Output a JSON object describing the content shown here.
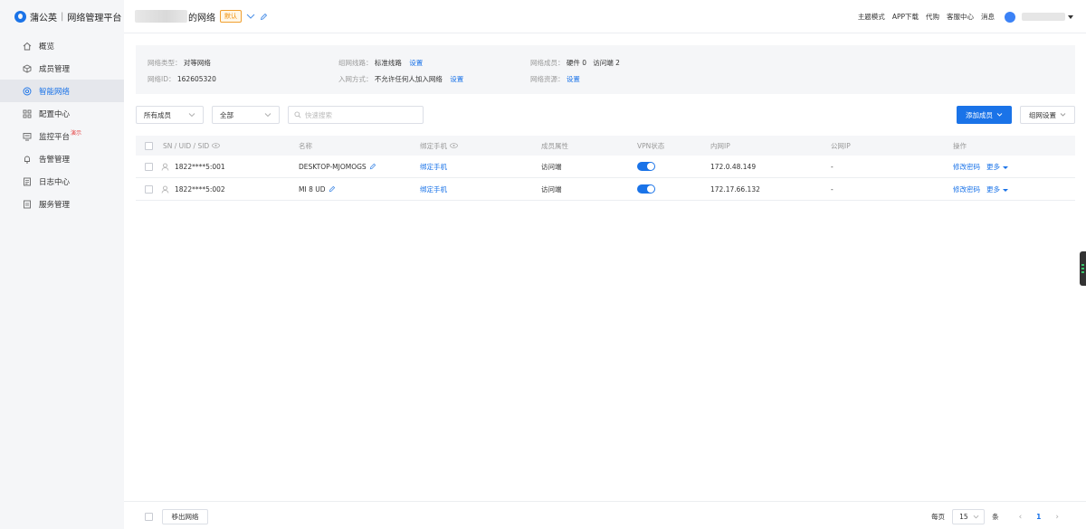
{
  "app": {
    "brand": "蒲公英",
    "platform": "网络管理平台"
  },
  "sidebar": {
    "items": [
      {
        "label": "概览",
        "icon": "home-icon"
      },
      {
        "label": "成员管理",
        "icon": "cube-icon"
      },
      {
        "label": "智能网络",
        "icon": "network-icon",
        "active": true
      },
      {
        "label": "配置中心",
        "icon": "grid-icon"
      },
      {
        "label": "监控平台",
        "icon": "monitor-icon",
        "badge": "演示"
      },
      {
        "label": "告警管理",
        "icon": "bell-icon"
      },
      {
        "label": "日志中心",
        "icon": "log-icon"
      },
      {
        "label": "服务管理",
        "icon": "service-icon"
      }
    ]
  },
  "header": {
    "network_title_suffix": "的网络",
    "default_tag": "默认",
    "links": [
      "主题模式",
      "APP下载",
      "代购",
      "客服中心",
      "消息"
    ]
  },
  "info": {
    "type_key": "网络类型：",
    "type_val": "对等网络",
    "route_key": "组网线路：",
    "route_val": "标准线路",
    "route_link": "设置",
    "members_key": "网络成员：",
    "members_val": "硬件 0   访问端 2",
    "id_key": "网络ID：",
    "id_val": "162605320",
    "join_key": "入网方式：",
    "join_val": "不允许任何人加入网络",
    "join_link": "设置",
    "res_key": "网络资源：",
    "res_link": "设置"
  },
  "filters": {
    "member_select": "所有成员",
    "status_select": "全部",
    "search_placeholder": "快速搜索",
    "add_member": "添加成员",
    "network_settings": "组网设置"
  },
  "table": {
    "headers": {
      "sn": "SN / UID / SID",
      "name": "名称",
      "phone": "绑定手机",
      "attr": "成员属性",
      "vpn": "VPN状态",
      "lan_ip": "内网IP",
      "wan_ip": "公网IP",
      "ops": "操作"
    },
    "rows": [
      {
        "sn": "1822****5:001",
        "name": "DESKTOP-MJOMOGS",
        "phone": "绑定手机",
        "attr": "访问端",
        "vpn_on": true,
        "lan_ip": "172.0.48.149",
        "wan_ip": "-",
        "op_edit": "修改密码",
        "op_more": "更多"
      },
      {
        "sn": "1822****5:002",
        "name": "MI 8 UD",
        "phone": "绑定手机",
        "attr": "访问端",
        "vpn_on": true,
        "lan_ip": "172.17.66.132",
        "wan_ip": "-",
        "op_edit": "修改密码",
        "op_more": "更多"
      }
    ]
  },
  "footer": {
    "move_out": "移出网络",
    "per_page_label": "每页",
    "per_page": "15",
    "unit": "条",
    "current_page": "1"
  },
  "colors": {
    "accent": "#1a73e8",
    "sidebar_bg": "#f5f6f8",
    "default_tag": "#f08c00"
  }
}
